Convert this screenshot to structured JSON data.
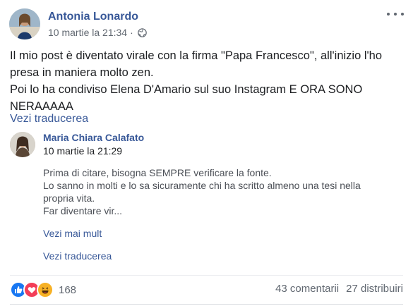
{
  "post": {
    "author": "Antonia Lonardo",
    "date": "10 martie la 21:34",
    "separator": "·",
    "privacy_icon": "globe-icon",
    "more_icon": "more-options-icon",
    "text_lines": [
      "Il mio post è diventato virale con la firma \"Papa Francesco\", all'inizio l'ho presa in maniera molto zen.",
      "Poi lo ha condiviso Elena D'Amario sul suo Instagram E ORA SONO NERAAAAA"
    ],
    "see_translation": "Vezi traducerea"
  },
  "shared": {
    "author": "Maria Chiara Calafato",
    "date": "10 martie la 21:29",
    "body_lines": [
      "Prima di citare, bisogna SEMPRE verificare la fonte.",
      "Lo sanno in molti e lo sa sicuramente chi ha scritto almeno una tesi nella propria vita.",
      "Far diventare vir..."
    ],
    "see_more": "Vezi mai mult",
    "see_translation": "Vezi traducerea"
  },
  "footer": {
    "reaction_icons": [
      "like-icon",
      "love-icon",
      "haha-icon"
    ],
    "reaction_count": "168",
    "comments": "43 comentarii",
    "shares": "27 distribuiri"
  },
  "colors": {
    "link": "#385898",
    "like": "#1877f2",
    "love": "#f33e58",
    "haha": "#f7b125"
  }
}
